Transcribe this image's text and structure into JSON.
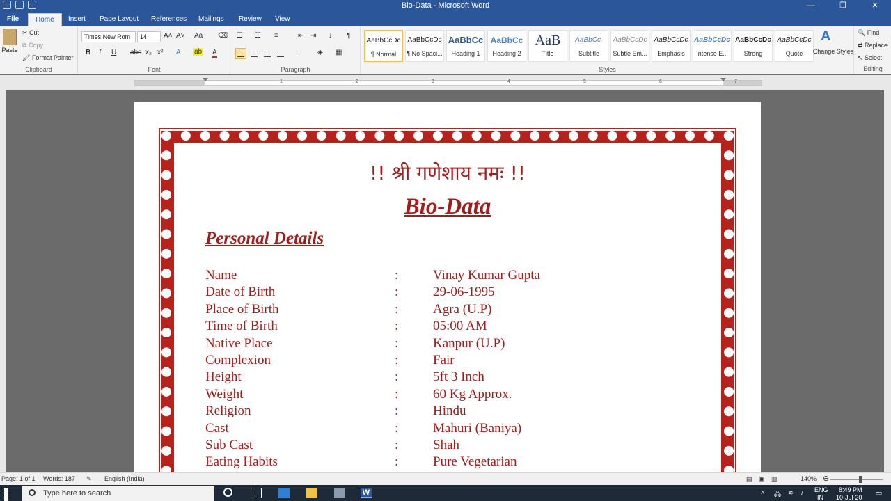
{
  "window": {
    "title": "Bio-Data - Microsoft Word",
    "controls": [
      "—",
      "❐",
      "✕"
    ]
  },
  "tabs": [
    "File",
    "Home",
    "Insert",
    "Page Layout",
    "References",
    "Mailings",
    "Review",
    "View"
  ],
  "ribbon": {
    "clipboard": {
      "label": "Clipboard",
      "paste": "Paste",
      "cut": "Cut",
      "copy": "Copy",
      "format_painter": "Format Painter"
    },
    "font": {
      "label": "Font",
      "name": "Times New Rom",
      "size": "14"
    },
    "paragraph": {
      "label": "Paragraph"
    },
    "styles": {
      "label": "Styles",
      "items": [
        {
          "preview": "AaBbCcDc",
          "name": "¶ Normal"
        },
        {
          "preview": "AaBbCcDc",
          "name": "¶ No Spaci..."
        },
        {
          "preview": "AaBbCc",
          "name": "Heading 1"
        },
        {
          "preview": "AaBbCc",
          "name": "Heading 2"
        },
        {
          "preview": "AaB",
          "name": "Title"
        },
        {
          "preview": "AaBbCc.",
          "name": "Subtitle"
        },
        {
          "preview": "AaBbCcDc",
          "name": "Subtle Em..."
        },
        {
          "preview": "AaBbCcDc",
          "name": "Emphasis"
        },
        {
          "preview": "AaBbCcDc",
          "name": "Intense E..."
        },
        {
          "preview": "AaBbCcDc",
          "name": "Strong"
        },
        {
          "preview": "AaBbCcDc",
          "name": "Quote"
        }
      ],
      "change_styles": "Change Styles"
    },
    "editing": {
      "label": "Editing",
      "find": "Find",
      "replace": "Replace",
      "select": "Select"
    }
  },
  "ruler_numbers": [
    "1",
    "2",
    "3",
    "4",
    "5",
    "6",
    "7"
  ],
  "document": {
    "mantra": "!! श्री गणेशाय नमः !!",
    "title": "Bio-Data",
    "section": "Personal Details",
    "details": [
      {
        "label": "Name",
        "value": "Vinay Kumar Gupta"
      },
      {
        "label": "Date of Birth",
        "value": "29-06-1995"
      },
      {
        "label": "Place of Birth",
        "value": "Agra (U.P)"
      },
      {
        "label": "Time of Birth",
        "value": "05:00 AM"
      },
      {
        "label": "Native Place",
        "value": "Kanpur (U.P)"
      },
      {
        "label": "Complexion",
        "value": "Fair"
      },
      {
        "label": "Height",
        "value": "5ft 3 Inch"
      },
      {
        "label": "Weight",
        "value": "60 Kg Approx."
      },
      {
        "label": "Religion",
        "value": "Hindu"
      },
      {
        "label": "Cast",
        "value": "Mahuri (Baniya)"
      },
      {
        "label": "Sub Cast",
        "value": "Shah"
      },
      {
        "label": "Eating Habits",
        "value": "Pure Vegetarian"
      }
    ],
    "separator": ":"
  },
  "statusbar": {
    "page": "Page: 1 of 1",
    "words": "Words: 187",
    "language": "English (India)",
    "zoom": "140%"
  },
  "taskbar": {
    "search_placeholder": "Type here to search",
    "lang": "ENG",
    "region": "IN",
    "time": "8:49 PM",
    "date": "10-Jul-20"
  },
  "colors": {
    "accent": "#2b579a",
    "border_red": "#b5231c",
    "text_red": "#a01e1b"
  }
}
